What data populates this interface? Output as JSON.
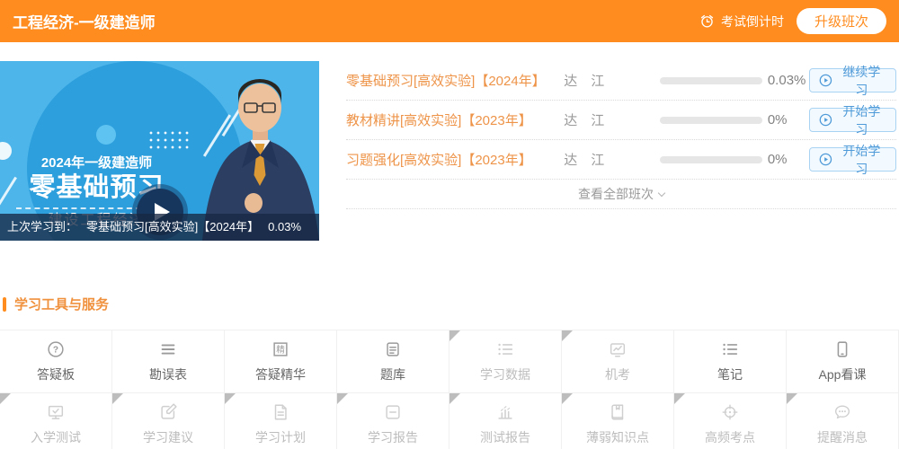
{
  "colors": {
    "accent_orange": "#ff8c1f",
    "course_title_orange": "#ee9449",
    "action_blue": "#4f9ad8",
    "thumbnail_blue": "#4db5ea"
  },
  "header": {
    "title": "工程经济-一级建造师",
    "countdown_label": "考试倒计时",
    "upgrade_button": "升级班次"
  },
  "player": {
    "thumbnail": {
      "line_year": "2024年一级建造师",
      "line_course": "零基础预习",
      "line_subject": "建设工程经济",
      "teacher": "达　江"
    },
    "last_learned": {
      "prefix": "上次学习到：",
      "course": "零基础预习[高效实验]【2024年】",
      "progress": "0.03%"
    }
  },
  "class_list": {
    "rows": [
      {
        "title": "零基础预习[高效实验]【2024年】",
        "teacher": "达　江",
        "progress_text": "0.03%",
        "progress_pct": 0.03,
        "action": "继续学习"
      },
      {
        "title": "教材精讲[高效实验]【2023年】",
        "teacher": "达　江",
        "progress_text": "0%",
        "progress_pct": 0,
        "action": "开始学习"
      },
      {
        "title": "习题强化[高效实验]【2023年】",
        "teacher": "达　江",
        "progress_text": "0%",
        "progress_pct": 0,
        "action": "开始学习"
      }
    ],
    "view_all": "查看全部班次"
  },
  "tools": {
    "section_title": "学习工具与服务",
    "items": [
      {
        "label": "答疑板",
        "icon": "question-circle-icon",
        "state": "normal"
      },
      {
        "label": "勘误表",
        "icon": "list-lines-icon",
        "state": "normal"
      },
      {
        "label": "答疑精华",
        "icon": "jing-badge-icon",
        "state": "normal"
      },
      {
        "label": "题库",
        "icon": "question-bank-icon",
        "state": "normal"
      },
      {
        "label": "学习数据",
        "icon": "bullet-list-icon",
        "state": "dim-marked"
      },
      {
        "label": "机考",
        "icon": "monitor-chart-icon",
        "state": "dim-marked"
      },
      {
        "label": "笔记",
        "icon": "bullet-list-icon",
        "state": "normal"
      },
      {
        "label": "App看课",
        "icon": "phone-icon",
        "state": "normal"
      },
      {
        "label": "入学测试",
        "icon": "monitor-check-icon",
        "state": "dim-marked"
      },
      {
        "label": "学习建议",
        "icon": "pencil-square-icon",
        "state": "dim-marked"
      },
      {
        "label": "学习计划",
        "icon": "document-icon",
        "state": "dim-marked"
      },
      {
        "label": "学习报告",
        "icon": "report-card-icon",
        "state": "dim-marked"
      },
      {
        "label": "测试报告",
        "icon": "bar-chart-icon",
        "state": "dim-marked"
      },
      {
        "label": "薄弱知识点",
        "icon": "book-icon",
        "state": "dim-marked"
      },
      {
        "label": "高频考点",
        "icon": "target-icon",
        "state": "dim-marked"
      },
      {
        "label": "提醒消息",
        "icon": "chat-bubble-icon",
        "state": "dim-marked"
      }
    ]
  }
}
